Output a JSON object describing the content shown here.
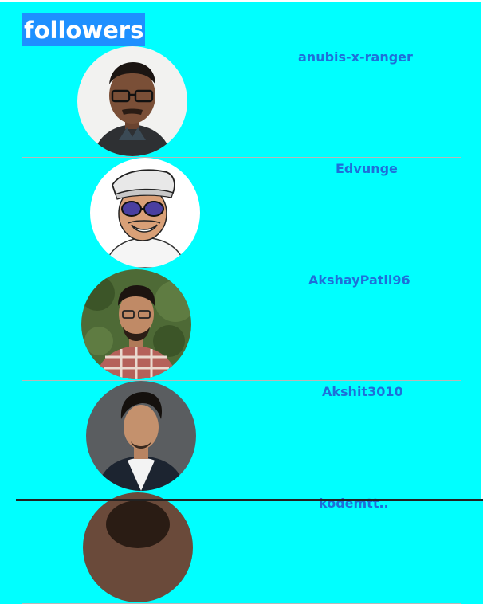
{
  "page": {
    "title": "followers"
  },
  "followers": [
    {
      "username": "anubis-x-ranger",
      "avatar_icon": "person-photo-avatar"
    },
    {
      "username": "Edvunge",
      "avatar_icon": "cartoon-avatar"
    },
    {
      "username": "AkshayPatil96",
      "avatar_icon": "person-photo-avatar"
    },
    {
      "username": "Akshit3010",
      "avatar_icon": "person-photo-avatar"
    },
    {
      "username": "kodemtt..",
      "avatar_icon": "person-photo-avatar"
    }
  ],
  "colors": {
    "background": "#00ffff",
    "title_bg": "#1e90ff",
    "username": "#1e6fd9"
  }
}
